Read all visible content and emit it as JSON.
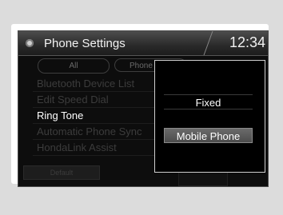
{
  "header": {
    "title": "Phone Settings",
    "clock": "12:34"
  },
  "tabs": [
    {
      "label": "All"
    },
    {
      "label": "Phone"
    }
  ],
  "menu": {
    "items": [
      {
        "label": "Bluetooth Device List"
      },
      {
        "label": "Edit Speed Dial"
      },
      {
        "label": "Ring Tone"
      },
      {
        "label": "Automatic Phone Sync"
      },
      {
        "label": "HondaLink Assist"
      }
    ],
    "default_label": "Default"
  },
  "popup": {
    "options": [
      {
        "label": "Fixed"
      },
      {
        "label": "Mobile Phone"
      }
    ],
    "selected": "Mobile Phone"
  }
}
